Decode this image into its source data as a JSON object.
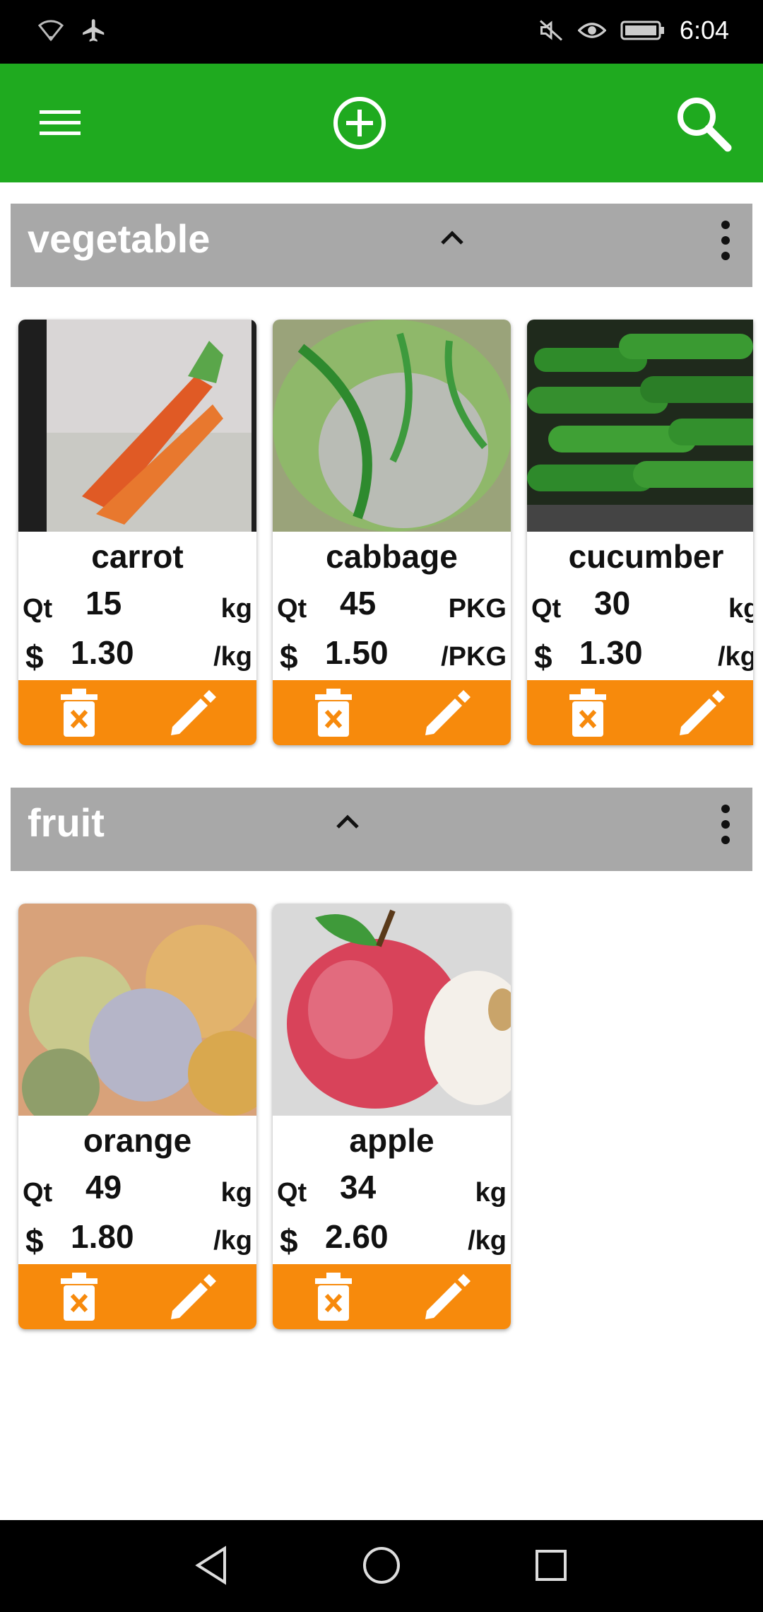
{
  "status_bar": {
    "time": "6:04"
  },
  "app_bar": {
    "menu_icon": "menu-icon",
    "add_icon": "add-circle-icon",
    "search_icon": "search-icon"
  },
  "colors": {
    "app_bar": "#1faa1f",
    "section_header": "#a8a8a8",
    "action_bar": "#f78a0c"
  },
  "categories": [
    {
      "title": "vegetable",
      "items": [
        {
          "name": "carrot",
          "qt_label": "Qt",
          "qt": "15",
          "qt_unit": "kg",
          "price_label": "$",
          "price": "1.30",
          "price_unit": "/kg"
        },
        {
          "name": "cabbage",
          "qt_label": "Qt",
          "qt": "45",
          "qt_unit": "PKG",
          "price_label": "$",
          "price": "1.50",
          "price_unit": "/PKG"
        },
        {
          "name": "cucumber",
          "qt_label": "Qt",
          "qt": "30",
          "qt_unit": "kg",
          "price_label": "$",
          "price": "1.30",
          "price_unit": "/kg"
        }
      ]
    },
    {
      "title": "fruit",
      "items": [
        {
          "name": "orange",
          "qt_label": "Qt",
          "qt": "49",
          "qt_unit": "kg",
          "price_label": "$",
          "price": "1.80",
          "price_unit": "/kg"
        },
        {
          "name": "apple",
          "qt_label": "Qt",
          "qt": "34",
          "qt_unit": "kg",
          "price_label": "$",
          "price": "2.60",
          "price_unit": "/kg"
        }
      ]
    }
  ]
}
